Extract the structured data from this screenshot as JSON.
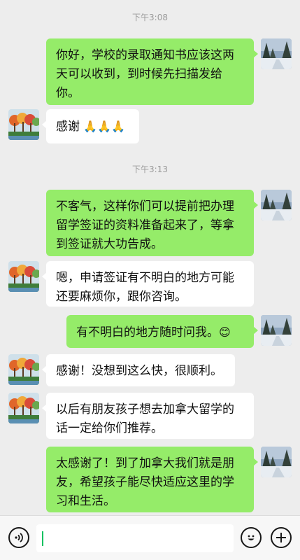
{
  "messages": [
    {
      "type": "time",
      "text": "下午3:08"
    },
    {
      "type": "out",
      "text": "你好，学校的录取通知书应该这两天可以收到，到时候先扫描发给你。"
    },
    {
      "type": "in",
      "text": "感谢 ",
      "emoji": "🙏🙏🙏"
    },
    {
      "type": "time",
      "text": "下午3:13"
    },
    {
      "type": "out",
      "text": "不客气，这样你们可以提前把办理留学签证的资料准备起来了，等拿到签证就大功告成。"
    },
    {
      "type": "in",
      "text": "嗯，申请签证有不明白的地方可能还要麻烦你，跟你咨询。"
    },
    {
      "type": "out",
      "text": "有不明白的地方随时问我。",
      "emoji": "😊"
    },
    {
      "type": "in",
      "text": "感谢！没想到这么快，很顺利。"
    },
    {
      "type": "in",
      "text": "以后有朋友孩子想去加拿大留学的话一定给你们推荐。"
    },
    {
      "type": "out",
      "text": "太感谢了！到了加拿大我们就是朋友，希望孩子能尽快适应这里的学习和生活。"
    }
  ],
  "input": {
    "value": ""
  },
  "icons": {
    "voice": "voice-icon",
    "emoji": "emoji-face-icon",
    "plus": "plus-icon",
    "self_avatar": "snowy-forest-avatar",
    "contact_avatar": "autumn-trees-painting-avatar"
  },
  "colors": {
    "outgoing_bubble": "#95ec69",
    "incoming_bubble": "#ffffff",
    "background": "#ededed",
    "cursor": "#07c160"
  }
}
